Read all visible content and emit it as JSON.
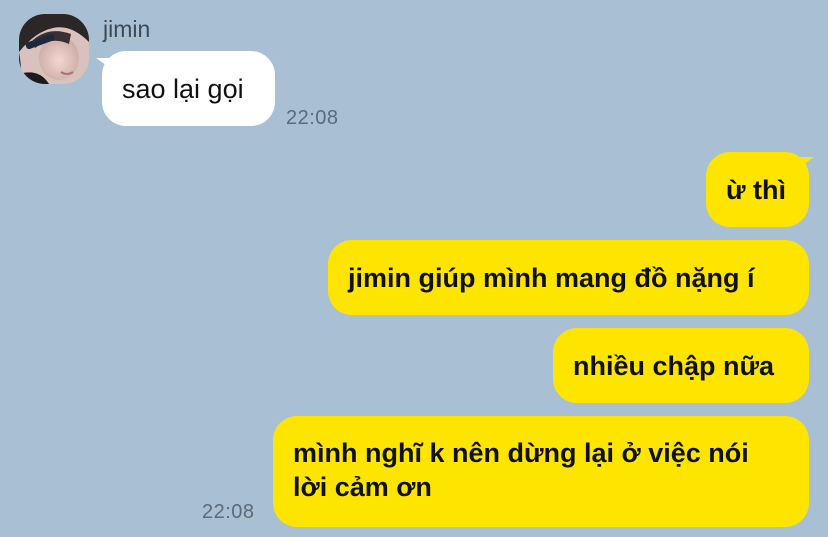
{
  "chat": {
    "contact_name": "jimin",
    "incoming": [
      {
        "text": "sao lại gọi",
        "time": "22:08"
      }
    ],
    "outgoing": [
      {
        "text": "ừ thì"
      },
      {
        "text": "jimin giúp mình mang đồ nặng í"
      },
      {
        "text": "nhiều chập nữa"
      },
      {
        "text": "mình nghĩ k nên dừng lại ở việc nói lời cảm ơn",
        "time": "22:08"
      }
    ]
  },
  "colors": {
    "background": "#a9bfd3",
    "incoming_bubble": "#ffffff",
    "outgoing_bubble": "#fee500"
  },
  "icons": {
    "avatar": "profile-photo"
  }
}
